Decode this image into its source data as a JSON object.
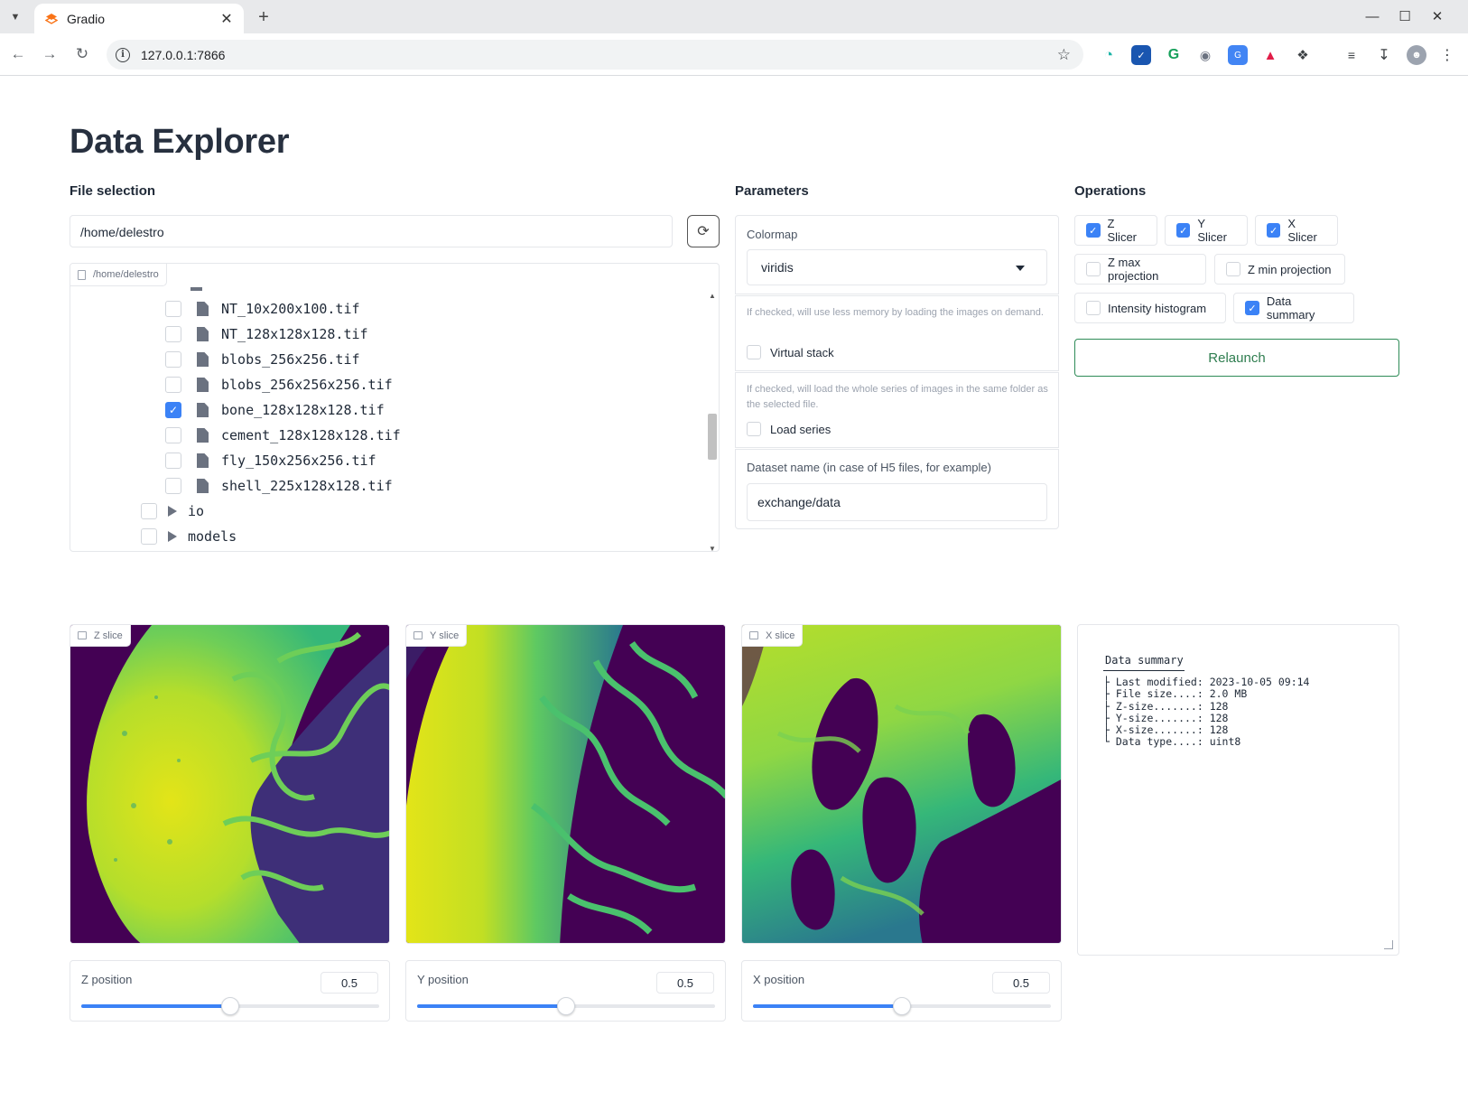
{
  "browser": {
    "tab_title": "Gradio",
    "url": "127.0.0.1:7866"
  },
  "page": {
    "title": "Data Explorer"
  },
  "file_selection": {
    "label": "File selection",
    "path_value": "/home/delestro",
    "panel_badge": "/home/delestro",
    "files": [
      {
        "name": "NT_10x200x100.tif",
        "checked": false,
        "type": "file"
      },
      {
        "name": "NT_128x128x128.tif",
        "checked": false,
        "type": "file"
      },
      {
        "name": "blobs_256x256.tif",
        "checked": false,
        "type": "file"
      },
      {
        "name": "blobs_256x256x256.tif",
        "checked": false,
        "type": "file"
      },
      {
        "name": "bone_128x128x128.tif",
        "checked": true,
        "type": "file"
      },
      {
        "name": "cement_128x128x128.tif",
        "checked": false,
        "type": "file"
      },
      {
        "name": "fly_150x256x256.tif",
        "checked": false,
        "type": "file"
      },
      {
        "name": "shell_225x128x128.tif",
        "checked": false,
        "type": "file"
      }
    ],
    "folders": [
      {
        "name": "io",
        "checked": false,
        "type": "folder"
      },
      {
        "name": "models",
        "checked": false,
        "type": "folder"
      }
    ]
  },
  "parameters": {
    "label": "Parameters",
    "colormap_label": "Colormap",
    "colormap_value": "viridis",
    "virtual_stack_info": "If checked, will use less memory by loading the images on demand.",
    "virtual_stack_label": "Virtual stack",
    "virtual_stack_checked": false,
    "load_series_info": "If checked, will load the whole series of images in the same folder as the selected file.",
    "load_series_label": "Load series",
    "load_series_checked": false,
    "dataset_label": "Dataset name (in case of H5 files, for example)",
    "dataset_value": "exchange/data"
  },
  "operations": {
    "label": "Operations",
    "items": [
      {
        "label": "Z Slicer",
        "checked": true
      },
      {
        "label": "Y Slicer",
        "checked": true
      },
      {
        "label": "X Slicer",
        "checked": true
      },
      {
        "label": "Z max projection",
        "checked": false
      },
      {
        "label": "Z min projection",
        "checked": false
      },
      {
        "label": "Intensity histogram",
        "checked": false
      },
      {
        "label": "Data summary",
        "checked": true
      }
    ],
    "relaunch_label": "Relaunch"
  },
  "slices": [
    {
      "badge": "Z slice",
      "position_label": "Z position",
      "position_value": "0.5",
      "fraction": 0.5
    },
    {
      "badge": "Y slice",
      "position_label": "Y position",
      "position_value": "0.5",
      "fraction": 0.5
    },
    {
      "badge": "X slice",
      "position_label": "X position",
      "position_value": "0.5",
      "fraction": 0.5
    }
  ],
  "summary": {
    "title": "Data summary",
    "lines": [
      "├ Last modified: 2023-10-05 09:14",
      "├ File size....: 2.0 MB",
      "├ Z-size.......: 128",
      "├ Y-size.......: 128",
      "├ X-size.......: 128",
      "└ Data type....: uint8"
    ]
  },
  "colors": {
    "accent_blue": "#3b82f6",
    "relaunch_green": "#2e7d4f",
    "viridis_dark": "#440154",
    "viridis_mid": "#21918c",
    "viridis_bright": "#fde725"
  }
}
